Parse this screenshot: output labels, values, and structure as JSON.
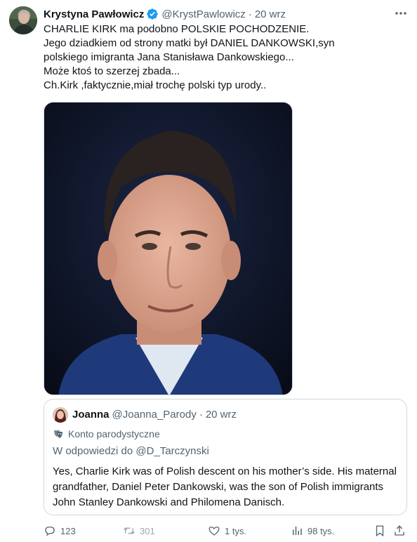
{
  "author": {
    "display_name": "Krystyna Pawłowicz",
    "handle": "@KrystPawlowicz",
    "time": "20 wrz",
    "separator": "·"
  },
  "tweet_lines": [
    "CHARLIE KIRK ma podobno POLSKIE POCHODZENIE.",
    "Jego dziadkiem od strony matki był DANIEL DANKOWSKI,syn",
    "polskiego imigranta Jana Stanisława Dankowskiego...",
    "Może ktoś to szerzej zbada...",
    "Ch.Kirk ,faktycznie,miał trochę polski typ urody.."
  ],
  "quote": {
    "display_name": "Joanna",
    "handle": "@Joanna_Parody",
    "separator": "·",
    "time": "20 wrz",
    "parody_label": "Konto parodystyczne",
    "reply_to": "W odpowiedzi do @D_Tarczynski",
    "text": "Yes, Charlie Kirk was of Polish descent on his mother’s side. His maternal grandfather, Daniel Peter Dankowski, was the son of Polish immigrants John Stanley Dankowski and Philomena Danisch."
  },
  "actions": {
    "replies": "123",
    "reposts": "301",
    "likes": "1 tys.",
    "views": "98 tys."
  },
  "colors": {
    "text": "#0f1419",
    "secondary": "#536471",
    "verified": "#1d9bf0",
    "border": "#cfd9de",
    "repost": "#9aa7b0"
  },
  "icons": [
    "verified-badge-icon",
    "more-icon",
    "theater-mask-icon",
    "reply-icon",
    "repost-icon",
    "like-icon",
    "views-icon",
    "bookmark-icon",
    "share-icon"
  ]
}
